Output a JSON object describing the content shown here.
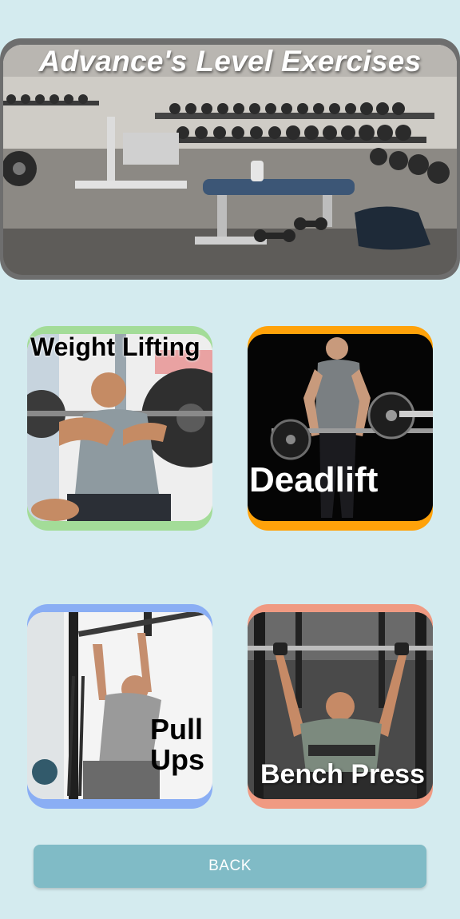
{
  "header": {
    "title": "Advance's Level Exercises"
  },
  "exercises": [
    {
      "label": "Weight Lifting",
      "border_color": "#a3dc98",
      "text_color": "#000000"
    },
    {
      "label": "Deadlift",
      "border_color": "#ffa20a",
      "text_color": "#ffffff"
    },
    {
      "label_line1": "Pull",
      "label_line2": "Ups",
      "border_color": "#8aaef4",
      "text_color": "#000000"
    },
    {
      "label": "Bench Press",
      "border_color": "#f09a82",
      "text_color": "#ffffff"
    }
  ],
  "footer": {
    "back_label": "BACK",
    "button_color": "#80bbc6"
  },
  "colors": {
    "background": "#d4ebef"
  }
}
